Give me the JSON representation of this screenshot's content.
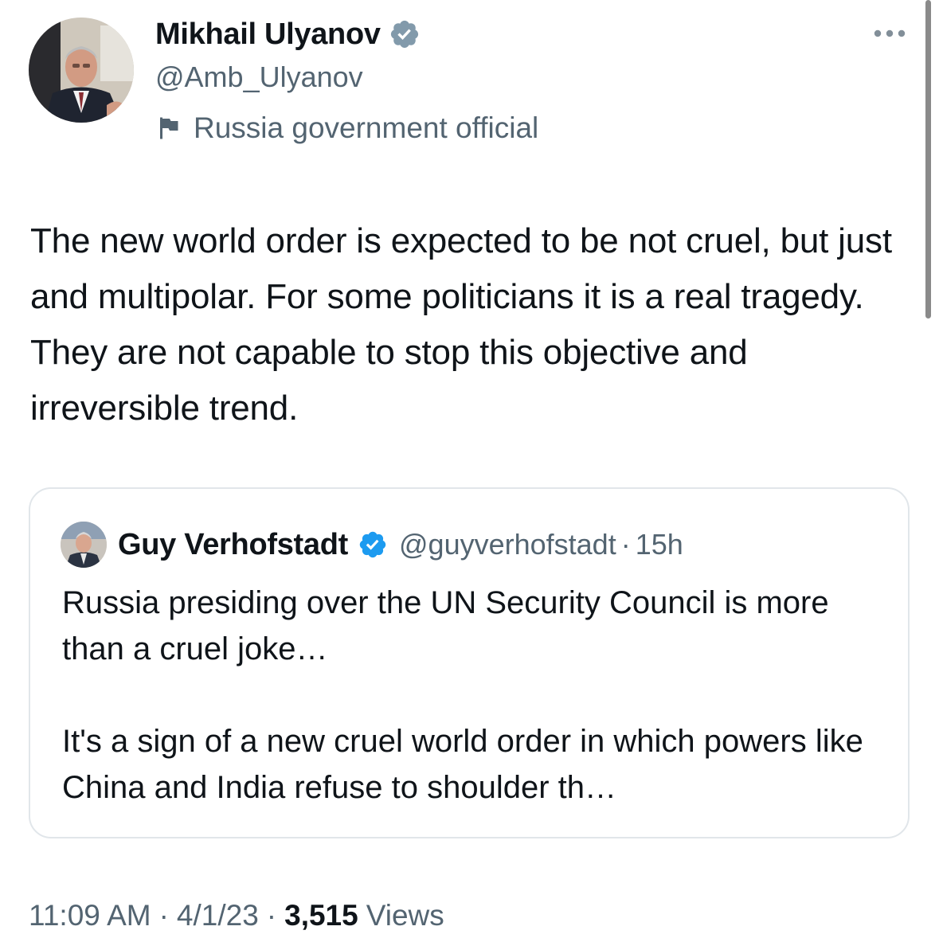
{
  "colors": {
    "text_primary": "#0f1419",
    "text_secondary": "#536471",
    "verified_blue": "#1d9bf0",
    "verified_gray": "#829aab",
    "card_border": "#e1e6ea"
  },
  "author": {
    "name": "Mikhail Ulyanov",
    "handle": "@Amb_Ulyanov",
    "verified_badge": "gray-checkmark",
    "affiliation": "Russia government official",
    "affiliation_icon": "flag-icon",
    "avatar": "profile-photo"
  },
  "header": {
    "more_icon": "more-dots-icon"
  },
  "tweet": {
    "text": "The new world order is expected to be not cruel, but just and multipolar. For some politicians it is a real tragedy. They are not capable to stop this objective and irreversible trend."
  },
  "quoted_tweet": {
    "author_name": "Guy Verhofstadt",
    "verified_badge": "blue-checkmark",
    "handle": "@guyverhofstadt",
    "separator": "·",
    "time": "15h",
    "paragraphs": [
      "Russia presiding over the UN Security Council is more than a cruel joke…",
      "It's a sign of a new cruel world order in which powers like China and India refuse to shoulder th…"
    ]
  },
  "meta": {
    "time": "11:09 AM",
    "separator": "·",
    "date": "4/1/23",
    "views_count": "3,515",
    "views_label": "Views"
  }
}
